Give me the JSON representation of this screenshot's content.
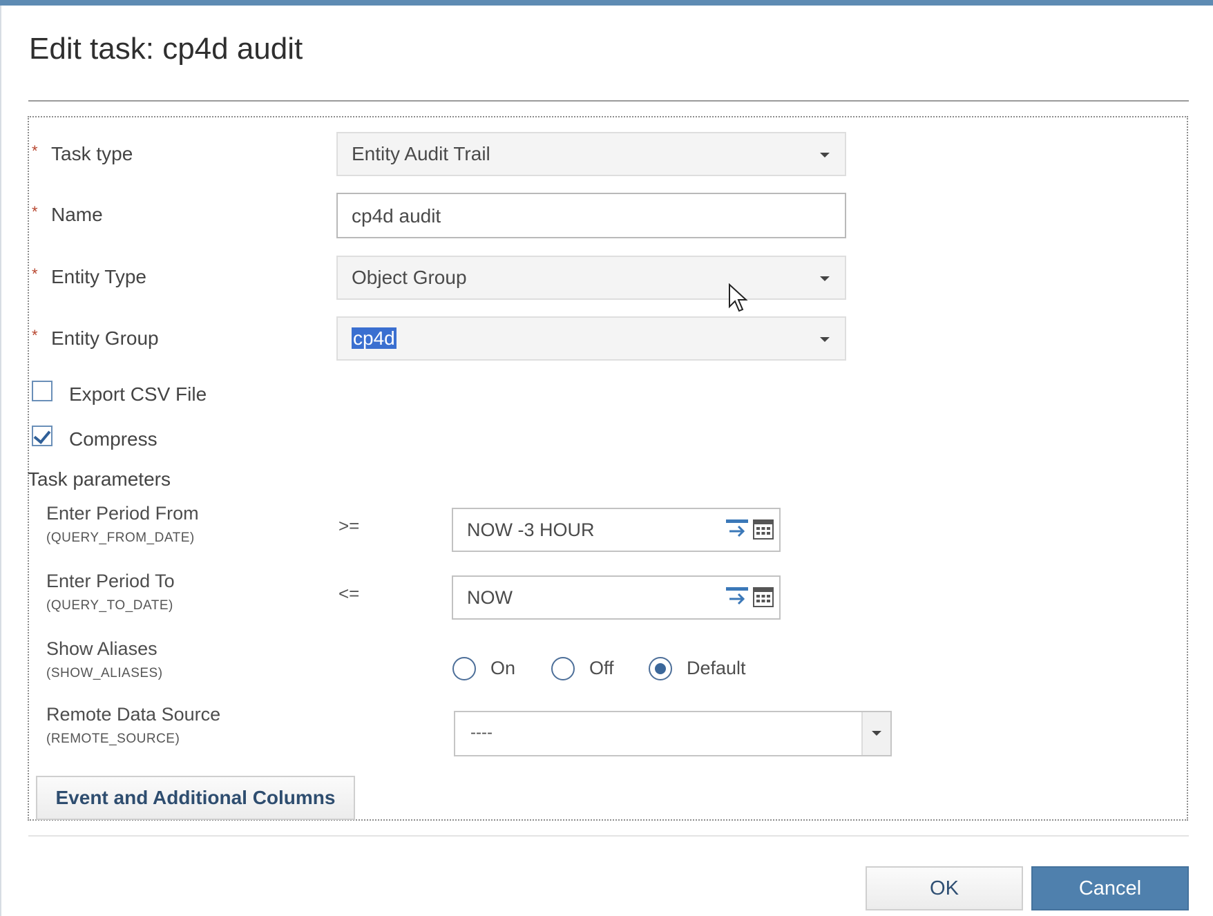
{
  "dialog": {
    "title": "Edit task: cp4d audit"
  },
  "form": {
    "task_type": {
      "label": "Task type",
      "value": "Entity Audit Trail"
    },
    "name": {
      "label": "Name",
      "value": "cp4d audit"
    },
    "entity_type": {
      "label": "Entity Type",
      "value": "Object Group"
    },
    "entity_group": {
      "label": "Entity Group",
      "value": "cp4d"
    },
    "export_csv": {
      "label": "Export CSV File",
      "checked": false
    },
    "compress": {
      "label": "Compress",
      "checked": true
    },
    "required_marker": "*"
  },
  "task_parameters": {
    "heading": "Task parameters",
    "period_from": {
      "label": "Enter Period From",
      "code": "(QUERY_FROM_DATE)",
      "operator": ">=",
      "value": "NOW -3 HOUR"
    },
    "period_to": {
      "label": "Enter Period To",
      "code": "(QUERY_TO_DATE)",
      "operator": "<=",
      "value": "NOW"
    },
    "show_aliases": {
      "label": "Show Aliases",
      "code": "(SHOW_ALIASES)",
      "options": [
        "On",
        "Off",
        "Default"
      ],
      "selected": "Default"
    },
    "remote_source": {
      "label": "Remote Data Source",
      "code": "(REMOTE_SOURCE)",
      "value": "----"
    },
    "columns_button": "Event and Additional Columns"
  },
  "footer": {
    "ok_label": "OK",
    "cancel_label": "Cancel"
  },
  "colors": {
    "accent": "#5e8bb3",
    "cancel_bg": "#4f80ad",
    "required": "#b7462f"
  }
}
